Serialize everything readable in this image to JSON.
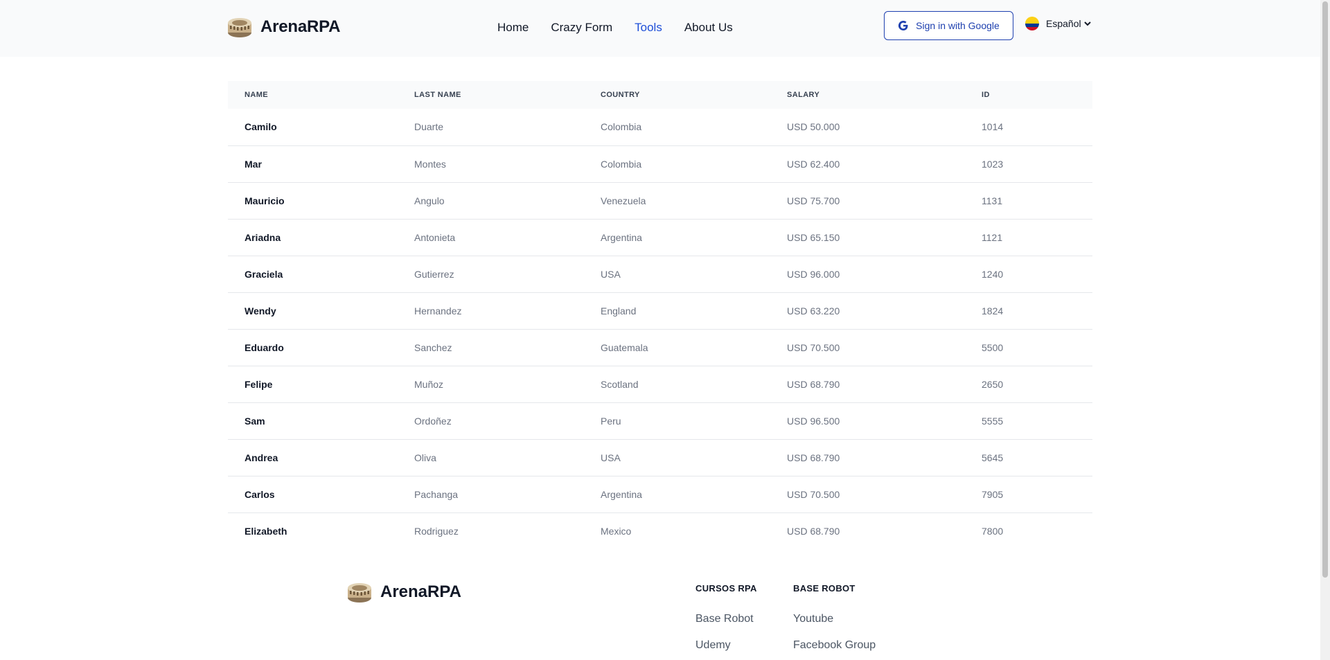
{
  "brand": {
    "name": "ArenaRPA"
  },
  "nav": [
    {
      "label": "Home",
      "active": false
    },
    {
      "label": "Crazy Form",
      "active": false
    },
    {
      "label": "Tools",
      "active": true
    },
    {
      "label": "About Us",
      "active": false
    }
  ],
  "signin": {
    "label": "Sign in with Google"
  },
  "language": {
    "label": "Español"
  },
  "colors": {
    "accent": "#1d4ed8",
    "button_border": "#1e40af"
  },
  "table": {
    "headers": [
      "NAME",
      "LAST NAME",
      "COUNTRY",
      "SALARY",
      "ID"
    ],
    "rows": [
      [
        "Camilo",
        "Duarte",
        "Colombia",
        "USD 50.000",
        "1014"
      ],
      [
        "Mar",
        "Montes",
        "Colombia",
        "USD 62.400",
        "1023"
      ],
      [
        "Mauricio",
        "Angulo",
        "Venezuela",
        "USD 75.700",
        "1131"
      ],
      [
        "Ariadna",
        "Antonieta",
        "Argentina",
        "USD 65.150",
        "1121"
      ],
      [
        "Graciela",
        "Gutierrez",
        "USA",
        "USD 96.000",
        "1240"
      ],
      [
        "Wendy",
        "Hernandez",
        "England",
        "USD 63.220",
        "1824"
      ],
      [
        "Eduardo",
        "Sanchez",
        "Guatemala",
        "USD 70.500",
        "5500"
      ],
      [
        "Felipe",
        "Muñoz",
        "Scotland",
        "USD 68.790",
        "2650"
      ],
      [
        "Sam",
        "Ordoñez",
        "Peru",
        "USD 96.500",
        "5555"
      ],
      [
        "Andrea",
        "Oliva",
        "USA",
        "USD 68.790",
        "5645"
      ],
      [
        "Carlos",
        "Pachanga",
        "Argentina",
        "USD 70.500",
        "7905"
      ],
      [
        "Elizabeth",
        "Rodriguez",
        "Mexico",
        "USD 68.790",
        "7800"
      ]
    ]
  },
  "footer": {
    "brand": "ArenaRPA",
    "columns": [
      {
        "title": "CURSOS RPA",
        "links": [
          "Base Robot",
          "Udemy"
        ]
      },
      {
        "title": "BASE ROBOT",
        "links": [
          "Youtube",
          "Facebook Group"
        ]
      }
    ]
  }
}
